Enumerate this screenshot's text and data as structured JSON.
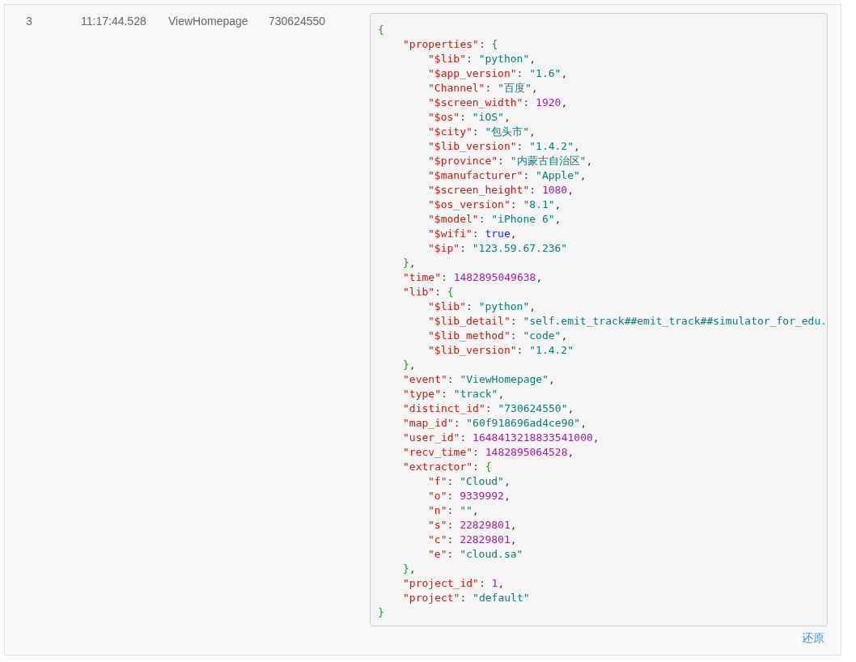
{
  "row": {
    "cells": [
      "3",
      "11:17:44.528",
      "ViewHomepage",
      "730624550"
    ],
    "code": {
      "tokens": [
        {
          "text": "{",
          "kind": "brace"
        }
      ],
      "close": [
        {
          "text": "}",
          "kind": "brace"
        }
      ],
      "children": [
        {
          "tokens": [
            {
              "text": "\"properties\"",
              "kind": "key"
            },
            {
              "text": ": ",
              "kind": "punct"
            },
            {
              "text": "{",
              "kind": "brace"
            }
          ],
          "close": [
            {
              "text": "}",
              "kind": "brace"
            },
            {
              "text": ",",
              "kind": "punct"
            }
          ],
          "children": [
            {
              "tokens": [
                {
                  "text": "\"$lib\"",
                  "kind": "key"
                },
                {
                  "text": ": ",
                  "kind": "punct"
                },
                {
                  "text": "\"python\"",
                  "kind": "string"
                },
                {
                  "text": ",",
                  "kind": "punct"
                }
              ]
            },
            {
              "tokens": [
                {
                  "text": "\"$app_version\"",
                  "kind": "key"
                },
                {
                  "text": ": ",
                  "kind": "punct"
                },
                {
                  "text": "\"1.6\"",
                  "kind": "string"
                },
                {
                  "text": ",",
                  "kind": "punct"
                }
              ]
            },
            {
              "tokens": [
                {
                  "text": "\"Channel\"",
                  "kind": "key"
                },
                {
                  "text": ": ",
                  "kind": "punct"
                },
                {
                  "text": "\"百度\"",
                  "kind": "string"
                },
                {
                  "text": ",",
                  "kind": "punct"
                }
              ]
            },
            {
              "tokens": [
                {
                  "text": "\"$screen_width\"",
                  "kind": "key"
                },
                {
                  "text": ": ",
                  "kind": "punct"
                },
                {
                  "text": "1920",
                  "kind": "number"
                },
                {
                  "text": ",",
                  "kind": "punct"
                }
              ]
            },
            {
              "tokens": [
                {
                  "text": "\"$os\"",
                  "kind": "key"
                },
                {
                  "text": ": ",
                  "kind": "punct"
                },
                {
                  "text": "\"iOS\"",
                  "kind": "string"
                },
                {
                  "text": ",",
                  "kind": "punct"
                }
              ]
            },
            {
              "tokens": [
                {
                  "text": "\"$city\"",
                  "kind": "key"
                },
                {
                  "text": ": ",
                  "kind": "punct"
                },
                {
                  "text": "\"包头市\"",
                  "kind": "string"
                },
                {
                  "text": ",",
                  "kind": "punct"
                }
              ]
            },
            {
              "tokens": [
                {
                  "text": "\"$lib_version\"",
                  "kind": "key"
                },
                {
                  "text": ": ",
                  "kind": "punct"
                },
                {
                  "text": "\"1.4.2\"",
                  "kind": "string"
                },
                {
                  "text": ",",
                  "kind": "punct"
                }
              ]
            },
            {
              "tokens": [
                {
                  "text": "\"$province\"",
                  "kind": "key"
                },
                {
                  "text": ": ",
                  "kind": "punct"
                },
                {
                  "text": "\"内蒙古自治区\"",
                  "kind": "string"
                },
                {
                  "text": ",",
                  "kind": "punct"
                }
              ]
            },
            {
              "tokens": [
                {
                  "text": "\"$manufacturer\"",
                  "kind": "key"
                },
                {
                  "text": ": ",
                  "kind": "punct"
                },
                {
                  "text": "\"Apple\"",
                  "kind": "string"
                },
                {
                  "text": ",",
                  "kind": "punct"
                }
              ]
            },
            {
              "tokens": [
                {
                  "text": "\"$screen_height\"",
                  "kind": "key"
                },
                {
                  "text": ": ",
                  "kind": "punct"
                },
                {
                  "text": "1080",
                  "kind": "number"
                },
                {
                  "text": ",",
                  "kind": "punct"
                }
              ]
            },
            {
              "tokens": [
                {
                  "text": "\"$os_version\"",
                  "kind": "key"
                },
                {
                  "text": ": ",
                  "kind": "punct"
                },
                {
                  "text": "\"8.1\"",
                  "kind": "string"
                },
                {
                  "text": ",",
                  "kind": "punct"
                }
              ]
            },
            {
              "tokens": [
                {
                  "text": "\"$model\"",
                  "kind": "key"
                },
                {
                  "text": ": ",
                  "kind": "punct"
                },
                {
                  "text": "\"iPhone 6\"",
                  "kind": "string"
                },
                {
                  "text": ",",
                  "kind": "punct"
                }
              ]
            },
            {
              "tokens": [
                {
                  "text": "\"$wifi\"",
                  "kind": "key"
                },
                {
                  "text": ": ",
                  "kind": "punct"
                },
                {
                  "text": "true",
                  "kind": "keyword"
                },
                {
                  "text": ",",
                  "kind": "punct"
                }
              ]
            },
            {
              "tokens": [
                {
                  "text": "\"$ip\"",
                  "kind": "key"
                },
                {
                  "text": ": ",
                  "kind": "punct"
                },
                {
                  "text": "\"123.59.67.236\"",
                  "kind": "string"
                }
              ]
            }
          ]
        },
        {
          "tokens": [
            {
              "text": "\"time\"",
              "kind": "key"
            },
            {
              "text": ": ",
              "kind": "punct"
            },
            {
              "text": "1482895049638",
              "kind": "number"
            },
            {
              "text": ",",
              "kind": "punct"
            }
          ]
        },
        {
          "tokens": [
            {
              "text": "\"lib\"",
              "kind": "key"
            },
            {
              "text": ": ",
              "kind": "punct"
            },
            {
              "text": "{",
              "kind": "brace"
            }
          ],
          "close": [
            {
              "text": "}",
              "kind": "brace"
            },
            {
              "text": ",",
              "kind": "punct"
            }
          ],
          "children": [
            {
              "tokens": [
                {
                  "text": "\"$lib\"",
                  "kind": "key"
                },
                {
                  "text": ": ",
                  "kind": "punct"
                },
                {
                  "text": "\"python\"",
                  "kind": "string"
                },
                {
                  "text": ",",
                  "kind": "punct"
                }
              ]
            },
            {
              "tokens": [
                {
                  "text": "\"$lib_detail\"",
                  "kind": "key"
                },
                {
                  "text": ": ",
                  "kind": "punct"
                },
                {
                  "text": "\"self.emit_track##emit_track##simulator_for_edu.",
                  "kind": "string"
                }
              ]
            },
            {
              "tokens": [
                {
                  "text": "\"$lib_method\"",
                  "kind": "key"
                },
                {
                  "text": ": ",
                  "kind": "punct"
                },
                {
                  "text": "\"code\"",
                  "kind": "string"
                },
                {
                  "text": ",",
                  "kind": "punct"
                }
              ]
            },
            {
              "tokens": [
                {
                  "text": "\"$lib_version\"",
                  "kind": "key"
                },
                {
                  "text": ": ",
                  "kind": "punct"
                },
                {
                  "text": "\"1.4.2\"",
                  "kind": "string"
                }
              ]
            }
          ]
        },
        {
          "tokens": [
            {
              "text": "\"event\"",
              "kind": "key"
            },
            {
              "text": ": ",
              "kind": "punct"
            },
            {
              "text": "\"ViewHomepage\"",
              "kind": "string"
            },
            {
              "text": ",",
              "kind": "punct"
            }
          ]
        },
        {
          "tokens": [
            {
              "text": "\"type\"",
              "kind": "key"
            },
            {
              "text": ": ",
              "kind": "punct"
            },
            {
              "text": "\"track\"",
              "kind": "string"
            },
            {
              "text": ",",
              "kind": "punct"
            }
          ]
        },
        {
          "tokens": [
            {
              "text": "\"distinct_id\"",
              "kind": "key"
            },
            {
              "text": ": ",
              "kind": "punct"
            },
            {
              "text": "\"730624550\"",
              "kind": "string"
            },
            {
              "text": ",",
              "kind": "punct"
            }
          ]
        },
        {
          "tokens": [
            {
              "text": "\"map_id\"",
              "kind": "key"
            },
            {
              "text": ": ",
              "kind": "punct"
            },
            {
              "text": "\"60f918696ad4ce90\"",
              "kind": "string"
            },
            {
              "text": ",",
              "kind": "punct"
            }
          ]
        },
        {
          "tokens": [
            {
              "text": "\"user_id\"",
              "kind": "key"
            },
            {
              "text": ": ",
              "kind": "punct"
            },
            {
              "text": "1648413218833541000",
              "kind": "number"
            },
            {
              "text": ",",
              "kind": "punct"
            }
          ]
        },
        {
          "tokens": [
            {
              "text": "\"recv_time\"",
              "kind": "key"
            },
            {
              "text": ": ",
              "kind": "punct"
            },
            {
              "text": "1482895064528",
              "kind": "number"
            },
            {
              "text": ",",
              "kind": "punct"
            }
          ]
        },
        {
          "tokens": [
            {
              "text": "\"extractor\"",
              "kind": "key"
            },
            {
              "text": ": ",
              "kind": "punct"
            },
            {
              "text": "{",
              "kind": "brace"
            }
          ],
          "close": [
            {
              "text": "}",
              "kind": "brace"
            },
            {
              "text": ",",
              "kind": "punct"
            }
          ],
          "children": [
            {
              "tokens": [
                {
                  "text": "\"f\"",
                  "kind": "key"
                },
                {
                  "text": ": ",
                  "kind": "punct"
                },
                {
                  "text": "\"Cloud\"",
                  "kind": "string"
                },
                {
                  "text": ",",
                  "kind": "punct"
                }
              ]
            },
            {
              "tokens": [
                {
                  "text": "\"o\"",
                  "kind": "key"
                },
                {
                  "text": ": ",
                  "kind": "punct"
                },
                {
                  "text": "9339992",
                  "kind": "number"
                },
                {
                  "text": ",",
                  "kind": "punct"
                }
              ]
            },
            {
              "tokens": [
                {
                  "text": "\"n\"",
                  "kind": "key"
                },
                {
                  "text": ": ",
                  "kind": "punct"
                },
                {
                  "text": "\"\"",
                  "kind": "string"
                },
                {
                  "text": ",",
                  "kind": "punct"
                }
              ]
            },
            {
              "tokens": [
                {
                  "text": "\"s\"",
                  "kind": "key"
                },
                {
                  "text": ": ",
                  "kind": "punct"
                },
                {
                  "text": "22829801",
                  "kind": "number"
                },
                {
                  "text": ",",
                  "kind": "punct"
                }
              ]
            },
            {
              "tokens": [
                {
                  "text": "\"c\"",
                  "kind": "key"
                },
                {
                  "text": ": ",
                  "kind": "punct"
                },
                {
                  "text": "22829801",
                  "kind": "number"
                },
                {
                  "text": ",",
                  "kind": "punct"
                }
              ]
            },
            {
              "tokens": [
                {
                  "text": "\"e\"",
                  "kind": "key"
                },
                {
                  "text": ": ",
                  "kind": "punct"
                },
                {
                  "text": "\"cloud.sa\"",
                  "kind": "string"
                }
              ]
            }
          ]
        },
        {
          "tokens": [
            {
              "text": "\"project_id\"",
              "kind": "key"
            },
            {
              "text": ": ",
              "kind": "punct"
            },
            {
              "text": "1",
              "kind": "number"
            },
            {
              "text": ",",
              "kind": "punct"
            }
          ]
        },
        {
          "tokens": [
            {
              "text": "\"project\"",
              "kind": "key"
            },
            {
              "text": ": ",
              "kind": "punct"
            },
            {
              "text": "\"default\"",
              "kind": "string"
            }
          ]
        }
      ]
    },
    "restore_link": "还原"
  }
}
